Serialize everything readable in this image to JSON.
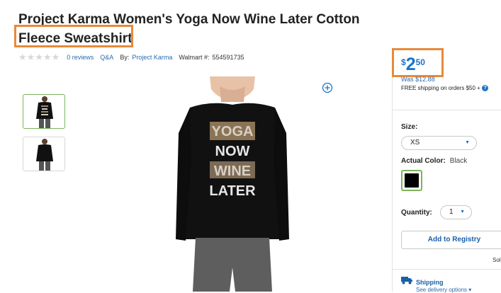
{
  "product": {
    "title_line1": "Project Karma Women's Yoga Now Wine Later Cotton",
    "title_line2": "Fleece Sweatshirt",
    "stars": "★★★★★",
    "reviews": "0 reviews",
    "qa": "Q&A",
    "by_label": "By:",
    "brand": "Project Karma",
    "walmart_label": "Walmart #:",
    "walmart_number": "554591735",
    "shirt_text": [
      "YOGA",
      "NOW",
      "WINE",
      "LATER"
    ]
  },
  "price": {
    "currency": "$",
    "dollars": "2",
    "cents": "50",
    "was": "Was $12.88",
    "free_shipping": "FREE shipping on orders $50 +",
    "help_icon": "?"
  },
  "options": {
    "size_label": "Size:",
    "size_value": "XS",
    "caret": "▼",
    "color_label": "Actual Color:",
    "color_value": "Black",
    "quantity_label": "Quantity:",
    "quantity_value": "1"
  },
  "actions": {
    "registry_label": "Add to Registry",
    "sold_label": "Sol"
  },
  "shipping": {
    "label": "Shipping",
    "delivery": "See delivery options ▾"
  },
  "colors": {
    "accent": "#1a73c9",
    "highlight": "#e8893a",
    "selected_border": "#7ab55c"
  }
}
